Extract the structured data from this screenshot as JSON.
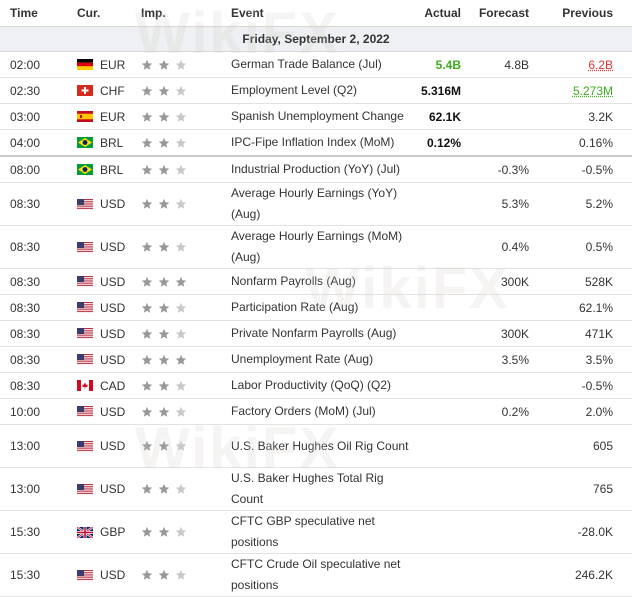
{
  "headers": {
    "time": "Time",
    "cur": "Cur.",
    "imp": "Imp.",
    "event": "Event",
    "actual": "Actual",
    "forecast": "Forecast",
    "previous": "Previous"
  },
  "day_label": "Friday, September 2, 2022",
  "watermark": "WikiFX",
  "colors": {
    "positive": "#3daa1f",
    "negative": "#e03333",
    "star_on": "#999999",
    "star_off": "#c8c8c8"
  },
  "rows": [
    {
      "time": "02:00",
      "flag": "de",
      "cur": "EUR",
      "stars": 2,
      "event": "German Trade Balance (Jul)",
      "actual": "5.4B",
      "actual_color": "positive",
      "forecast": "4.8B",
      "previous": "6.2B",
      "previous_color": "negative",
      "previous_revised": true
    },
    {
      "time": "02:30",
      "flag": "ch",
      "cur": "CHF",
      "stars": 2,
      "event": "Employment Level (Q2)",
      "actual": "5.316M",
      "forecast": "",
      "previous": "5.273M",
      "previous_color": "positive",
      "previous_revised": true
    },
    {
      "time": "03:00",
      "flag": "es",
      "cur": "EUR",
      "stars": 2,
      "event": "Spanish Unemployment Change",
      "actual": "62.1K",
      "forecast": "",
      "previous": "3.2K"
    },
    {
      "time": "04:00",
      "flag": "br",
      "cur": "BRL",
      "stars": 2,
      "event": "IPC-Fipe Inflation Index (MoM)",
      "actual": "0.12%",
      "forecast": "",
      "previous": "0.16%",
      "thick": true
    },
    {
      "time": "08:00",
      "flag": "br",
      "cur": "BRL",
      "stars": 2,
      "event": "Industrial Production (YoY) (Jul)",
      "actual": "",
      "forecast": "-0.3%",
      "previous": "-0.5%"
    },
    {
      "time": "08:30",
      "flag": "us",
      "cur": "USD",
      "stars": 2,
      "event": "Average Hourly Earnings (YoY) (Aug)",
      "actual": "",
      "forecast": "5.3%",
      "previous": "5.2%",
      "tall": true
    },
    {
      "time": "08:30",
      "flag": "us",
      "cur": "USD",
      "stars": 2,
      "event": "Average Hourly Earnings (MoM) (Aug)",
      "actual": "",
      "forecast": "0.4%",
      "previous": "0.5%",
      "tall": true
    },
    {
      "time": "08:30",
      "flag": "us",
      "cur": "USD",
      "stars": 3,
      "event": "Nonfarm Payrolls (Aug)",
      "actual": "",
      "forecast": "300K",
      "previous": "528K"
    },
    {
      "time": "08:30",
      "flag": "us",
      "cur": "USD",
      "stars": 2,
      "event": "Participation Rate (Aug)",
      "actual": "",
      "forecast": "",
      "previous": "62.1%"
    },
    {
      "time": "08:30",
      "flag": "us",
      "cur": "USD",
      "stars": 2,
      "event": "Private Nonfarm Payrolls (Aug)",
      "actual": "",
      "forecast": "300K",
      "previous": "471K"
    },
    {
      "time": "08:30",
      "flag": "us",
      "cur": "USD",
      "stars": 3,
      "event": "Unemployment Rate (Aug)",
      "actual": "",
      "forecast": "3.5%",
      "previous": "3.5%"
    },
    {
      "time": "08:30",
      "flag": "ca",
      "cur": "CAD",
      "stars": 2,
      "event": "Labor Productivity (QoQ) (Q2)",
      "actual": "",
      "forecast": "",
      "previous": "-0.5%"
    },
    {
      "time": "10:00",
      "flag": "us",
      "cur": "USD",
      "stars": 2,
      "event": "Factory Orders (MoM) (Jul)",
      "actual": "",
      "forecast": "0.2%",
      "previous": "2.0%"
    },
    {
      "time": "13:00",
      "flag": "us",
      "cur": "USD",
      "stars": 2,
      "event": "U.S. Baker Hughes Oil Rig Count",
      "actual": "",
      "forecast": "",
      "previous": "605",
      "tall": true
    },
    {
      "time": "13:00",
      "flag": "us",
      "cur": "USD",
      "stars": 2,
      "event": "U.S. Baker Hughes Total Rig Count",
      "actual": "",
      "forecast": "",
      "previous": "765",
      "tall": true
    },
    {
      "time": "15:30",
      "flag": "gb",
      "cur": "GBP",
      "stars": 2,
      "event": "CFTC GBP speculative net positions",
      "actual": "",
      "forecast": "",
      "previous": "-28.0K",
      "tall": true
    },
    {
      "time": "15:30",
      "flag": "us",
      "cur": "USD",
      "stars": 2,
      "event": "CFTC Crude Oil speculative net positions",
      "actual": "",
      "forecast": "",
      "previous": "246.2K",
      "tall": true
    }
  ]
}
